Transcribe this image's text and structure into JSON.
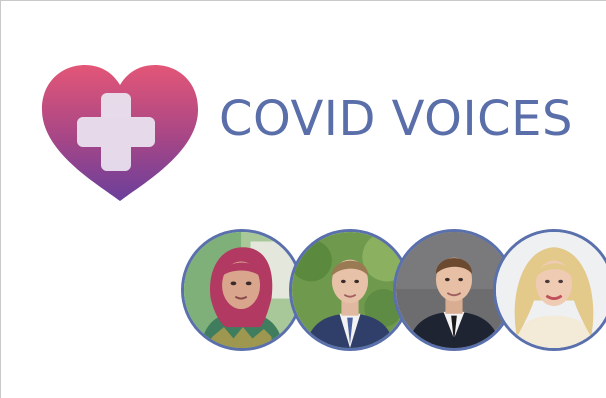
{
  "brand": {
    "title": "COVID VOICES",
    "title_color": "#5a6eaa",
    "heart_gradient_top": "#e05478",
    "heart_gradient_bottom": "#6e3f9a",
    "cross_color": "#e8e1ee",
    "logo_icon": "heart-plus-icon"
  },
  "avatars": [
    {
      "id": "person-1",
      "icon": "woman-portrait"
    },
    {
      "id": "person-2",
      "icon": "man-portrait"
    },
    {
      "id": "person-3",
      "icon": "man-portrait"
    },
    {
      "id": "person-4",
      "icon": "woman-portrait"
    }
  ],
  "colors": {
    "avatar_border": "#5a70ad",
    "frame_border": "#c9c9c9"
  }
}
